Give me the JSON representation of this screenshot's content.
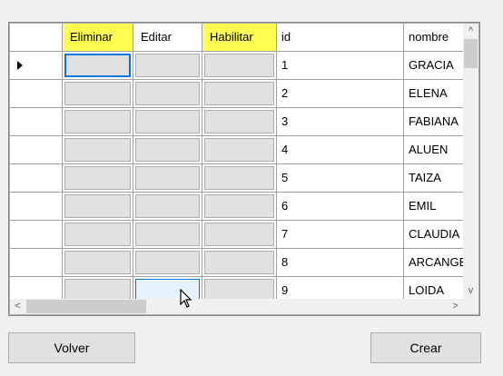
{
  "grid": {
    "columns": [
      "",
      "Eliminar",
      "Editar",
      "Habilitar",
      "id",
      "nombre"
    ],
    "highlighted_columns": [
      "Eliminar",
      "Habilitar"
    ],
    "highlight_color": "#ffff33",
    "rows": [
      {
        "id": "1",
        "nombre": "GRACIA",
        "current": true
      },
      {
        "id": "2",
        "nombre": "ELENA"
      },
      {
        "id": "3",
        "nombre": "FABIANA"
      },
      {
        "id": "4",
        "nombre": "ALUEN"
      },
      {
        "id": "5",
        "nombre": "TAIZA"
      },
      {
        "id": "6",
        "nombre": "EMIL"
      },
      {
        "id": "7",
        "nombre": "CLAUDIA"
      },
      {
        "id": "8",
        "nombre": "ARCANGEL"
      },
      {
        "id": "9",
        "nombre": "LOIDA"
      }
    ],
    "scroll_up_glyph": "^",
    "scroll_down_glyph": "v",
    "scroll_left_glyph": "<",
    "scroll_right_glyph": ">"
  },
  "buttons": {
    "volver": "Volver",
    "crear": "Crear"
  },
  "colors": {
    "focus_border": "#0078d7",
    "grid_button": "#e1e1e1",
    "window_bg": "#f0f0f0"
  }
}
